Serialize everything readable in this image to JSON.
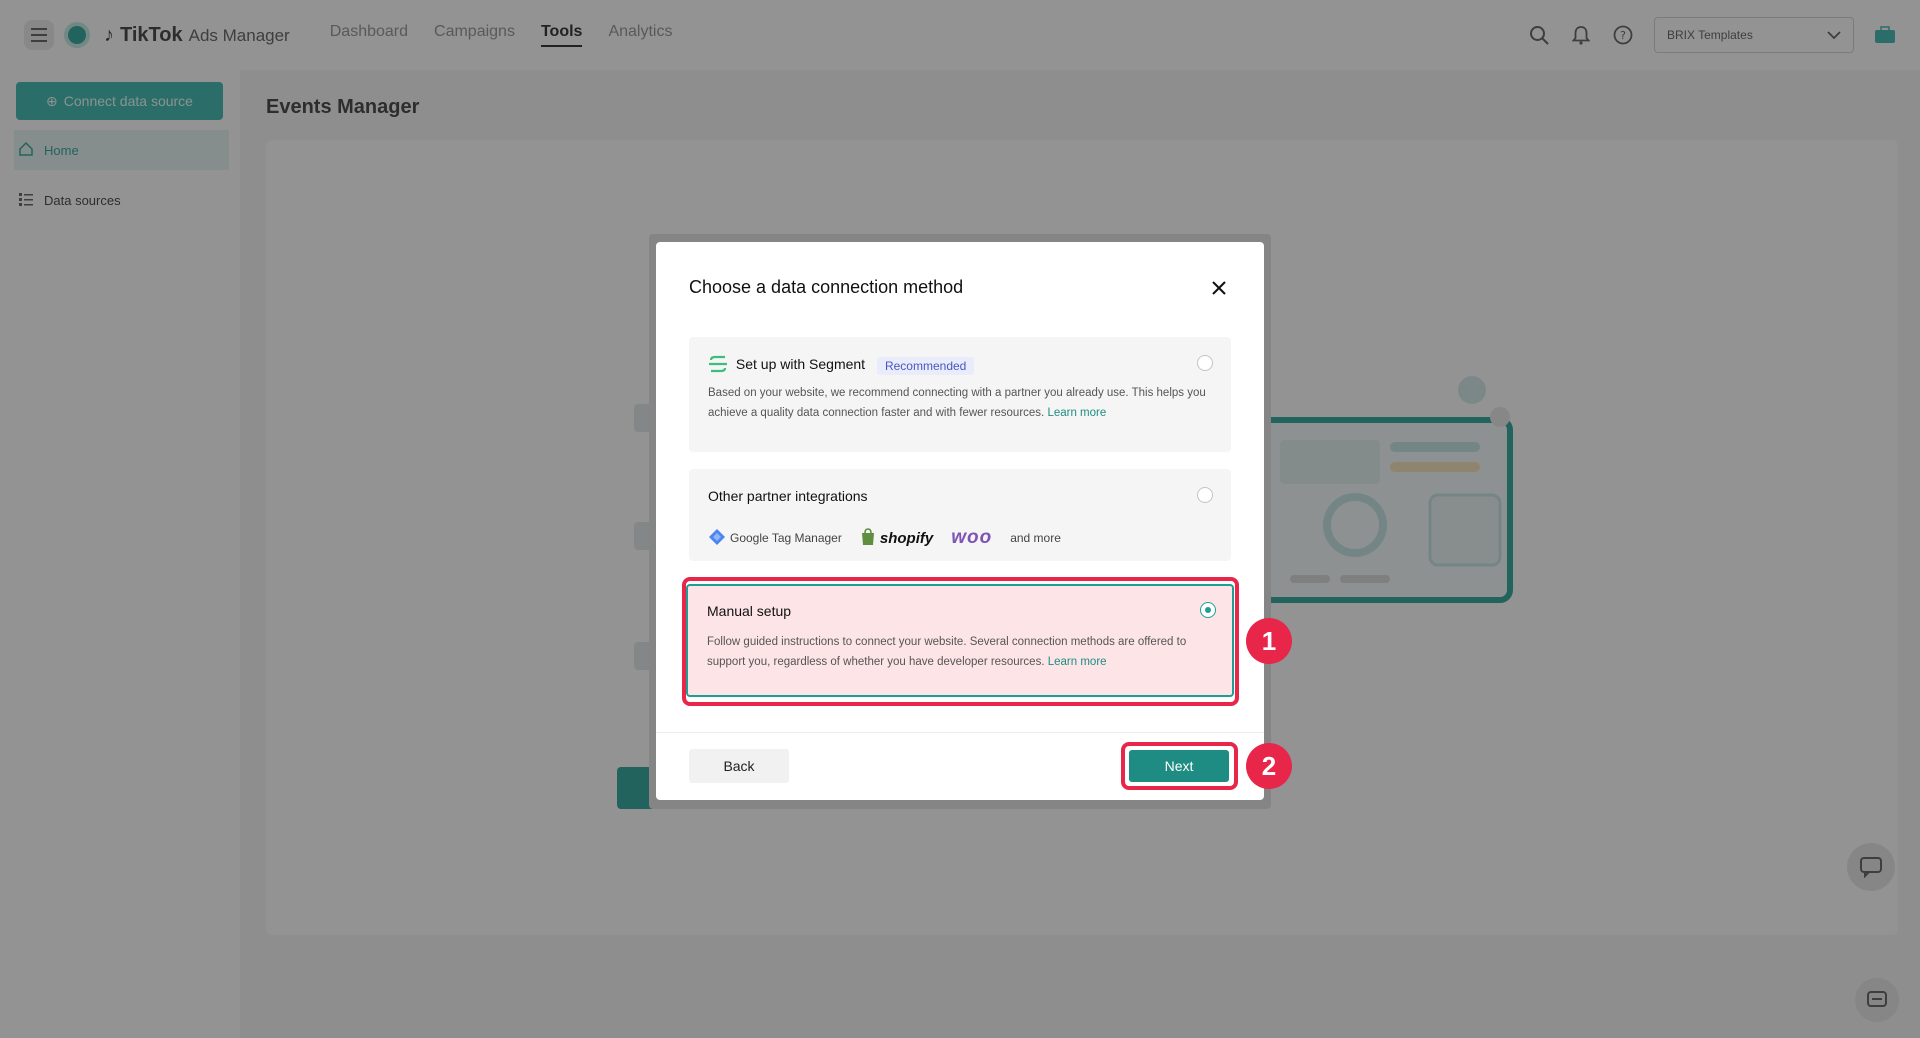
{
  "app": {
    "brand": "TikTok",
    "brand_sub": "Ads Manager",
    "nav": [
      "Dashboard",
      "Campaigns",
      "Tools",
      "Analytics"
    ],
    "nav_active": "Tools",
    "account": "BRIX Templates"
  },
  "sidebar": {
    "connect_label": "Connect data source",
    "items": [
      {
        "label": "Home",
        "icon": "home-icon"
      },
      {
        "label": "Data sources",
        "icon": "list-icon"
      }
    ]
  },
  "page": {
    "title": "Events Manager"
  },
  "modal": {
    "title": "Choose a data connection method",
    "options": [
      {
        "title": "Set up with Segment",
        "badge": "Recommended",
        "desc": "Based on your website, we recommend connecting with a partner you already use. This helps you achieve a quality data connection faster and with fewer resources.",
        "learn": "Learn more",
        "selected": false
      },
      {
        "title": "Other partner integrations",
        "partners": [
          "Google Tag Manager",
          "shopify",
          "woo",
          "and more"
        ],
        "selected": false
      },
      {
        "title": "Manual setup",
        "desc": "Follow guided instructions to connect your website. Several connection methods are offered to support you, regardless of whether you have developer resources.",
        "learn": "Learn more",
        "selected": true
      }
    ],
    "back_label": "Back",
    "next_label": "Next"
  },
  "annotations": {
    "step1": "1",
    "step2": "2"
  },
  "colors": {
    "accent": "#1f8c84",
    "highlight": "#e8264a",
    "selected_bg": "#fde4e6"
  }
}
